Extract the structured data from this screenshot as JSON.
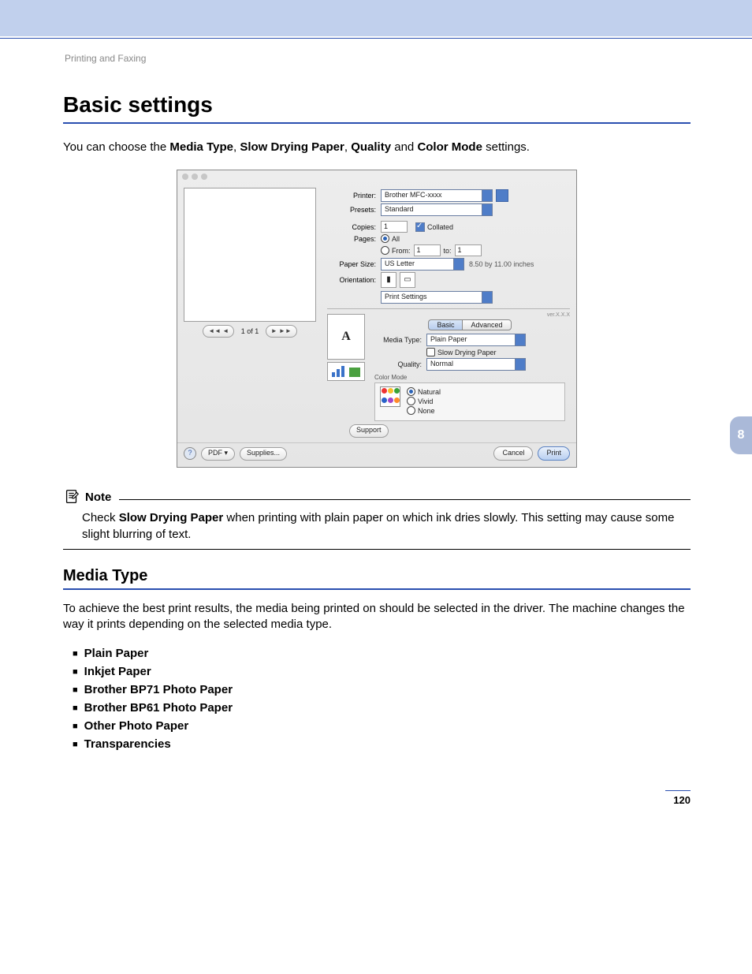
{
  "document": {
    "running_head": "Printing and Faxing",
    "page_number": "120",
    "chapter_tab": "8",
    "h1": "Basic settings",
    "intro": {
      "pre": "You can choose the ",
      "b1": "Media Type",
      "sep1": ", ",
      "b2": "Slow Drying Paper",
      "sep2": ", ",
      "b3": "Quality",
      "sep3": " and ",
      "b4": "Color Mode",
      "post": " settings."
    },
    "note": {
      "label": "Note",
      "pre": "Check ",
      "bold": "Slow Drying Paper",
      "post": " when printing with plain paper on which ink dries slowly. This setting may cause some slight blurring of text."
    },
    "h2": "Media Type",
    "media_text": "To achieve the best print results, the media being printed on should be selected in the driver. The machine changes the way it prints depending on the selected media type.",
    "media_items": [
      "Plain Paper",
      "Inkjet Paper",
      "Brother BP71 Photo Paper",
      "Brother BP61 Photo Paper",
      "Other Photo Paper",
      "Transparencies"
    ]
  },
  "dialog": {
    "printer_label": "Printer:",
    "printer_value": "Brother MFC-xxxx",
    "presets_label": "Presets:",
    "presets_value": "Standard",
    "copies_label": "Copies:",
    "copies_value": "1",
    "collated_label": "Collated",
    "pages_label": "Pages:",
    "pages_all": "All",
    "pages_from": "From:",
    "pages_from_v": "1",
    "pages_to": "to:",
    "pages_to_v": "1",
    "papersize_label": "Paper Size:",
    "papersize_value": "US Letter",
    "papersize_dim": "8.50 by 11.00 inches",
    "orientation_label": "Orientation:",
    "panel_value": "Print Settings",
    "version_label": "ver.X.X.X",
    "tab_basic": "Basic",
    "tab_advanced": "Advanced",
    "mediatype_label": "Media Type:",
    "mediatype_value": "Plain Paper",
    "slowdry_label": "Slow Drying Paper",
    "quality_label": "Quality:",
    "quality_value": "Normal",
    "colormode_label": "Color Mode",
    "cm_natural": "Natural",
    "cm_vivid": "Vivid",
    "cm_none": "None",
    "pager_text": "1 of 1",
    "pager_prev": "◄◄  ◄",
    "pager_next": "►  ►►",
    "support_btn": "Support",
    "pdf_btn": "PDF ▾",
    "supplies_btn": "Supplies...",
    "cancel_btn": "Cancel",
    "print_btn": "Print",
    "orient_portrait_glyph": "▮",
    "orient_landscape_glyph": "▭"
  }
}
